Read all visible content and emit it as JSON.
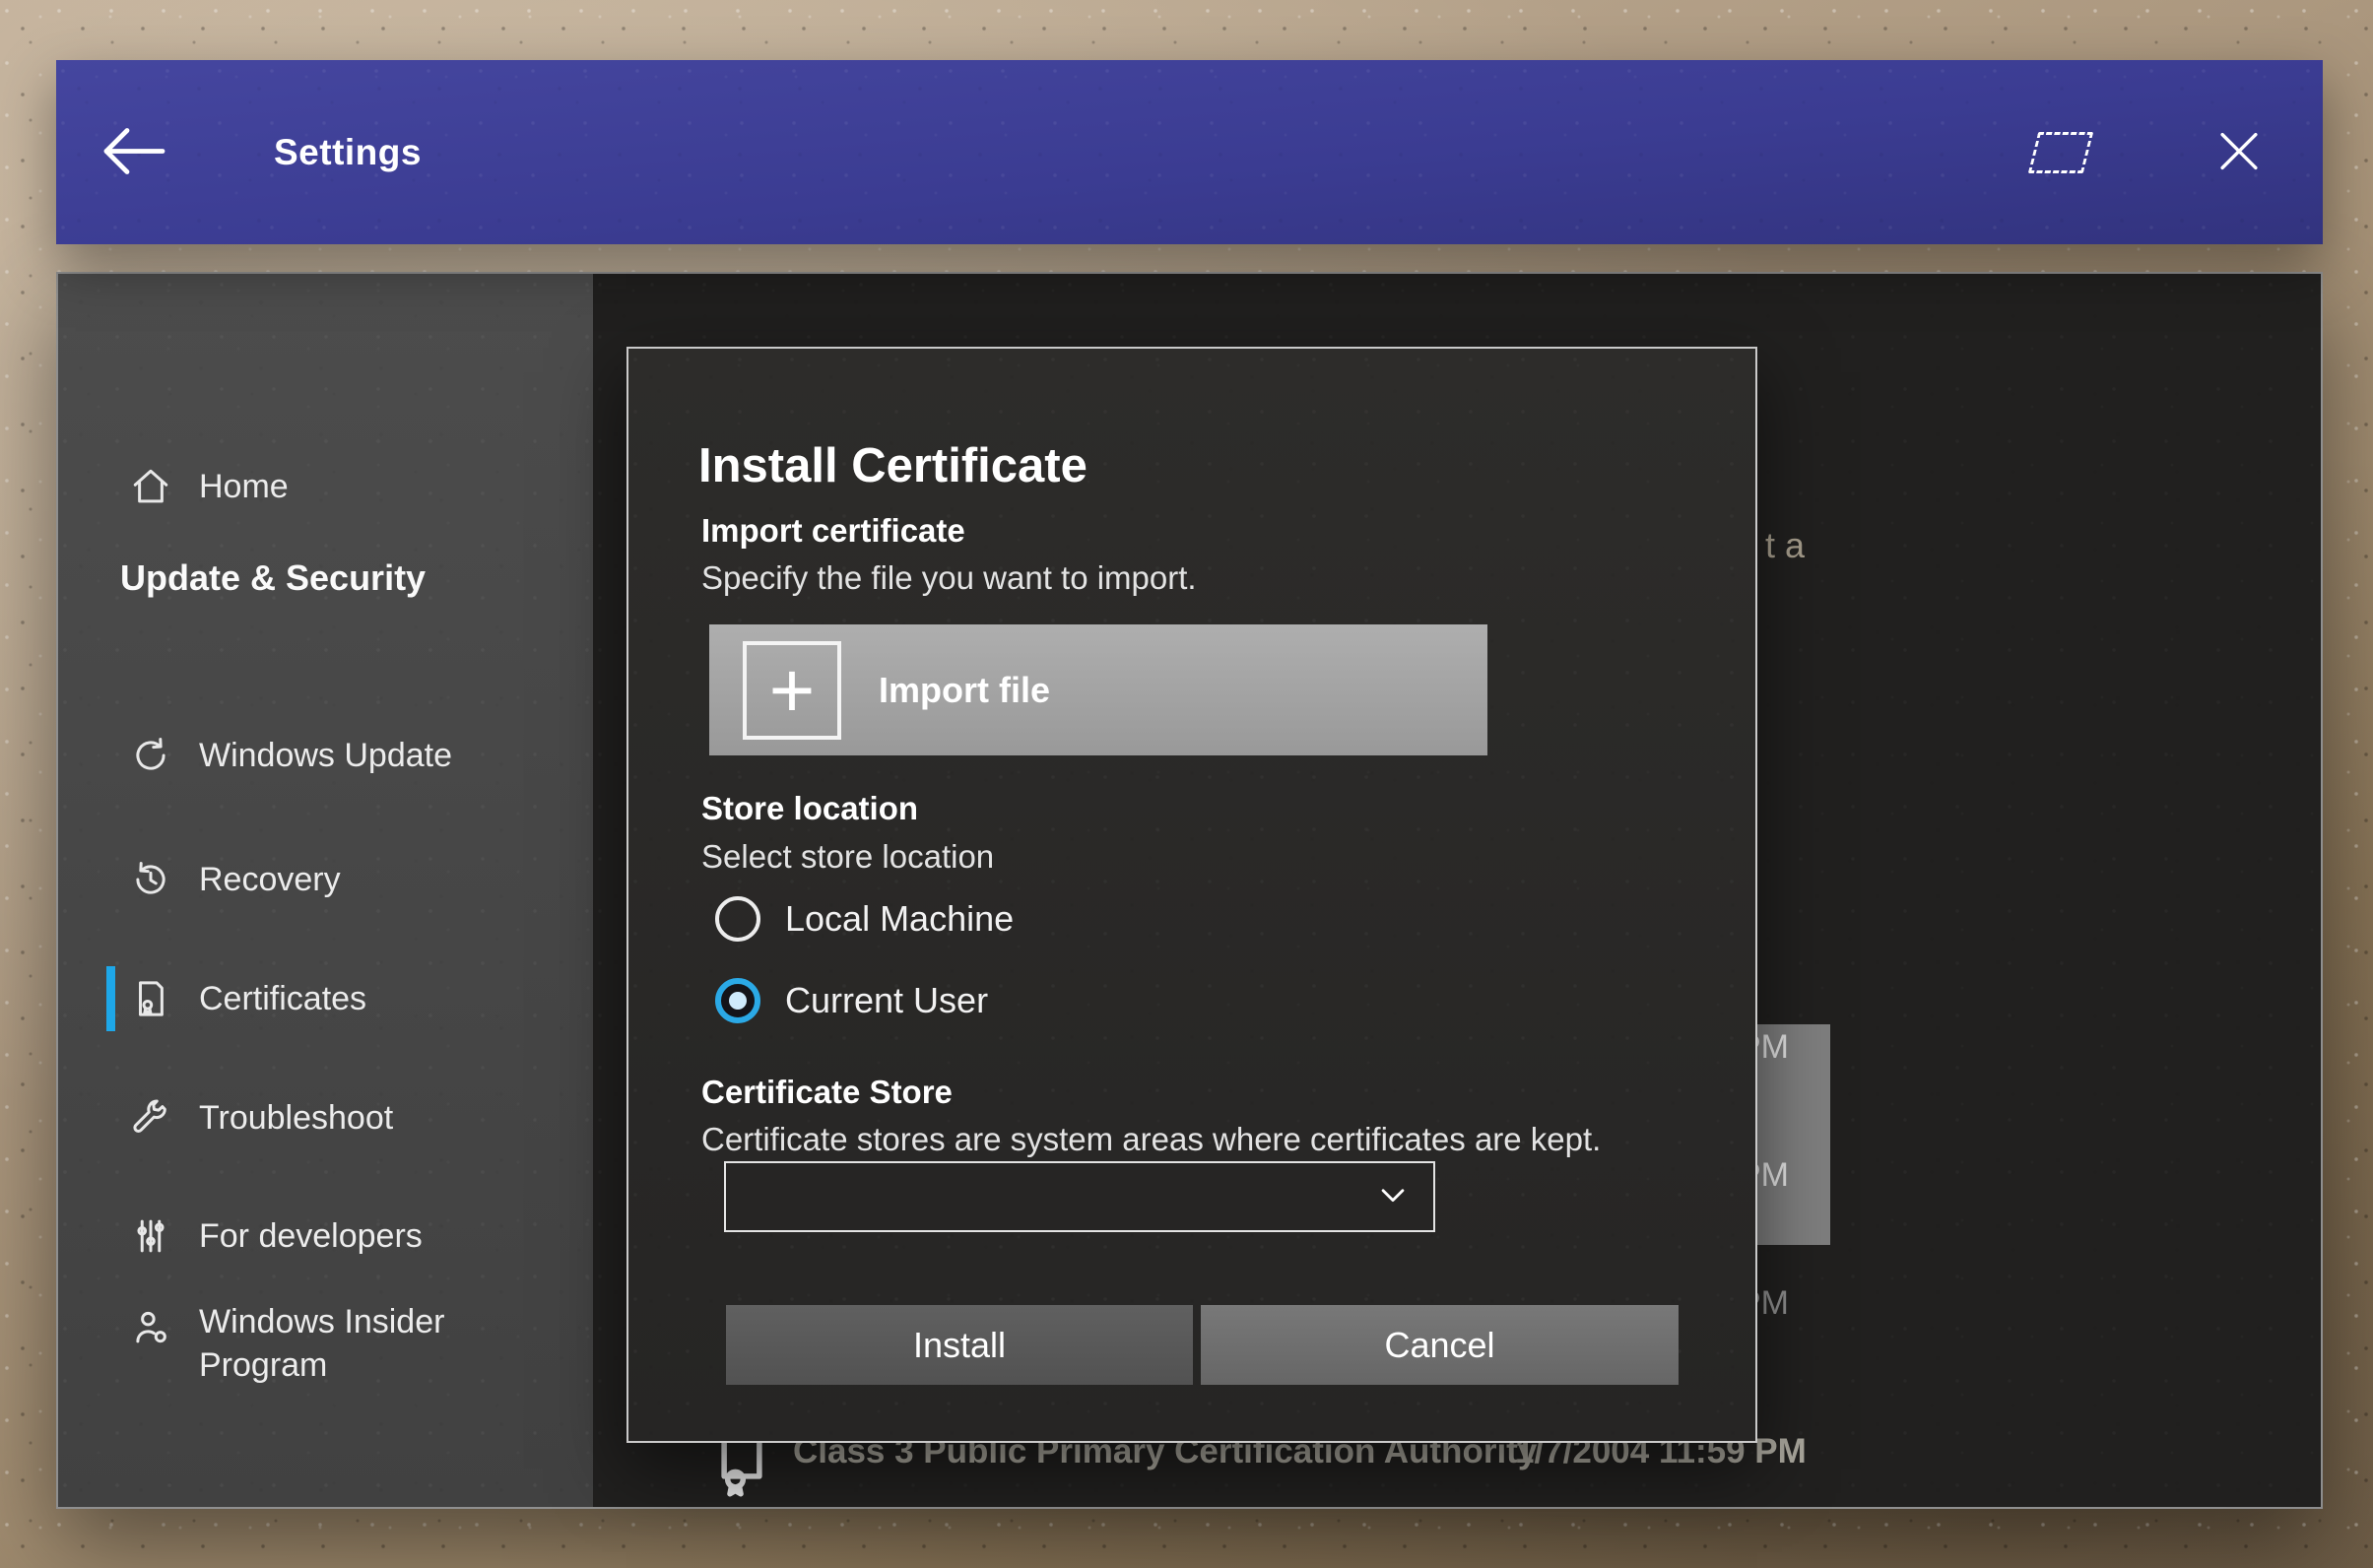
{
  "colors": {
    "titlebar_blue": "#3b3c92",
    "accent_blue": "#1ea7e8",
    "radio_selected": "#2ba9e6",
    "dialog_bg": "#2a2928",
    "wall_tan": "#ac987f"
  },
  "titlebar": {
    "title": "Settings"
  },
  "sidebar": {
    "selected_item": "Certificates",
    "items": [
      {
        "label": "Home",
        "icon": "home-icon",
        "selected": false
      },
      {
        "label": "Update & Security",
        "icon": null,
        "type": "header"
      },
      {
        "label": "Windows Update",
        "icon": "sync-icon",
        "selected": false
      },
      {
        "label": "Recovery",
        "icon": "history-icon",
        "selected": false
      },
      {
        "label": "Certificates",
        "icon": "certificate-icon",
        "selected": true
      },
      {
        "label": "Troubleshoot",
        "icon": "wrench-icon",
        "selected": false
      },
      {
        "label": "For developers",
        "icon": "dev-sliders-icon",
        "selected": false
      },
      {
        "label": "Windows Insider Program",
        "icon": "person-icon",
        "selected": false
      }
    ]
  },
  "background_list": {
    "clipped_text": "t a",
    "time_fragments": [
      "PM",
      "PM",
      "PM"
    ],
    "visible_row": {
      "name": "Class 3 Public Primary Certification Authority",
      "date": "1/7/2004 11:59 PM"
    }
  },
  "dialog": {
    "title": "Install Certificate",
    "import": {
      "heading": "Import certificate",
      "subtext": "Specify the file you want to import.",
      "button": "Import file"
    },
    "store_location": {
      "heading": "Store location",
      "subtext": "Select store location",
      "selected_option": "Current User",
      "options": [
        {
          "label": "Local Machine",
          "selected": false
        },
        {
          "label": "Current User",
          "selected": true
        }
      ]
    },
    "cert_store": {
      "heading": "Certificate Store",
      "subtext": "Certificate stores are system areas where certificates are kept.",
      "dropdown_value": ""
    },
    "install_button": "Install",
    "cancel_button": "Cancel"
  }
}
